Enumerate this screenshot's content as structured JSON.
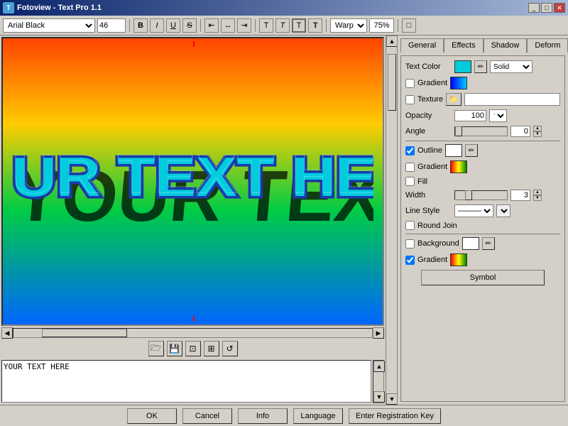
{
  "window": {
    "title": "Fotoview - Text Pro 1.1",
    "icon": "T"
  },
  "titlebar_buttons": [
    "_",
    "□",
    "✕"
  ],
  "toolbar": {
    "font_name": "Arial Black",
    "font_size": "46",
    "bold_label": "B",
    "italic_label": "I",
    "underline_label": "U",
    "strikethrough_label": "S",
    "align_left": "≡",
    "align_center": "≡",
    "align_right": "≡",
    "text_btn1": "T",
    "text_btn2": "T",
    "text_btn3": "T",
    "text_btn4": "T",
    "warp_label": "Warp",
    "warp_percent": "75%",
    "extra_btn": "□"
  },
  "tabs": [
    "General",
    "Effects",
    "Shadow",
    "Deform"
  ],
  "active_tab": "General",
  "general": {
    "text_color_label": "Text Color",
    "gradient_label": "Gradient",
    "texture_label": "Texture",
    "opacity_label": "Opacity",
    "opacity_value": "100",
    "angle_label": "Angle",
    "angle_value": "0",
    "outline_label": "Outline",
    "outline_gradient_label": "Gradient",
    "fill_label": "Fill",
    "width_label": "Width",
    "width_value": "3",
    "line_style_label": "Line Style",
    "round_join_label": "Round Join",
    "background_label": "Background",
    "bg_gradient_label": "Gradient",
    "symbol_label": "Symbol",
    "solid_label": "Solid",
    "line_options": [
      "———",
      "- - -",
      "· · ·"
    ]
  },
  "canvas": {
    "text": "YOUR TEXT HERE",
    "text_display": "YOUR TEXT HERE"
  },
  "bottom_buttons": [
    "OK",
    "Cancel",
    "Info",
    "Language",
    "Enter Registration Key"
  ]
}
